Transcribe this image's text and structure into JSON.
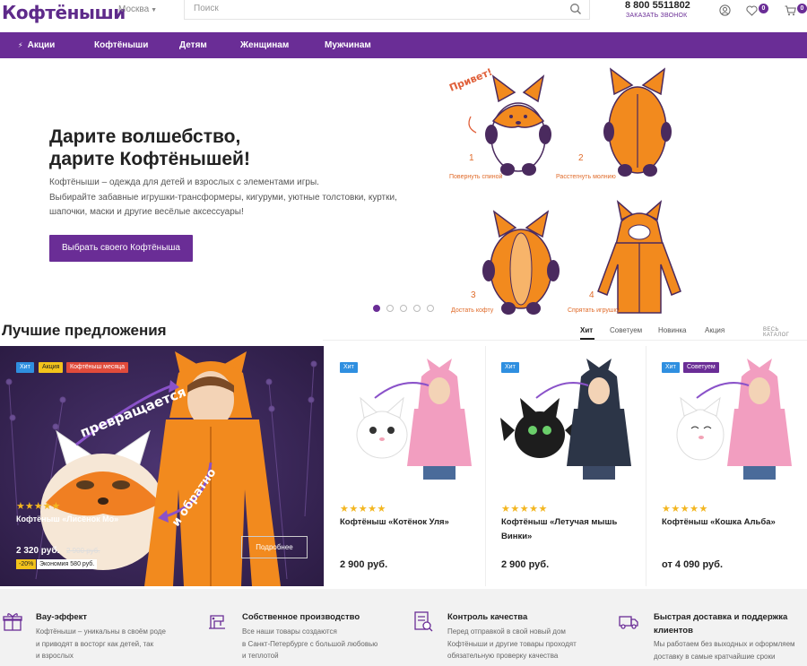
{
  "header": {
    "logo": "Кофтёныши",
    "city": "Москва",
    "search_placeholder": "Поиск",
    "phone": "8 800 5511802",
    "callback": "ЗАКАЗАТЬ ЗВОНОК",
    "wishlist_count": "0",
    "cart_count": "0"
  },
  "nav": {
    "items": [
      "Акции",
      "Кофтёныши",
      "Детям",
      "Женщинам",
      "Мужчинам"
    ]
  },
  "hero": {
    "title_line1": "Дарите волшебство,",
    "title_line2": "дарите Кофтёнышей!",
    "desc_line1": "Кофтёныши – одежда для детей и взрослых с элементами игры.",
    "desc_line2": "Выбирайте забавные игрушки-трансформеры, кигуруми, уютные толстовки, куртки,",
    "desc_line3": "шапочки, маски и другие весёлые аксессуары!",
    "button": "Выбрать своего Кофтёныша",
    "greeting": "Привет!",
    "steps": [
      {
        "num": "1",
        "label": "Повернуть спиной"
      },
      {
        "num": "2",
        "label": "Расстегнуть молнию"
      },
      {
        "num": "3",
        "label": "Достать кофту"
      },
      {
        "num": "4",
        "label": "Спрятать игрушку"
      }
    ]
  },
  "offers": {
    "title": "Лучшие предложения",
    "tabs": [
      "Хит",
      "Советуем",
      "Новинка",
      "Акция"
    ],
    "catalog_link": "ВЕСЬ КАТАЛОГ",
    "transform_text": "превращается",
    "reverse_text": "и обратно",
    "featured": {
      "tags": [
        "Хит",
        "Акция",
        "Кофтёныш месяца"
      ],
      "stars": "★★★★★",
      "name": "Кофтёныш «Лисёнок Мо»",
      "price": "2 320 руб.",
      "old_price": "2 900 руб.",
      "discount": "-20%",
      "economy": "Экономия 580 руб.",
      "more_button": "Подробнее"
    },
    "products": [
      {
        "tags": [
          "Хит"
        ],
        "stars": "★★★★★",
        "name": "Кофтёныш «Котёнок Уля»",
        "price": "2 900 руб."
      },
      {
        "tags": [
          "Хит"
        ],
        "stars": "★★★★★",
        "name": "Кофтёныш «Летучая мышь Винки»",
        "price": "2 900 руб."
      },
      {
        "tags": [
          "Хит",
          "Советуем"
        ],
        "stars": "★★★★★",
        "name": "Кофтёныш «Кошка Альба»",
        "price": "от 4 090 руб."
      }
    ]
  },
  "features": [
    {
      "title": "Вау-эффект",
      "text1": "Кофтёныши – уникальны в своём роде",
      "text2": "и приводят в восторг как детей, так",
      "text3": "и взрослых"
    },
    {
      "title": "Собственное производство",
      "text1": "Все наши товары создаются",
      "text2": "в Санкт-Петербурге с большой любовью",
      "text3": "и теплотой"
    },
    {
      "title": "Контроль качества",
      "text1": "Перед отправкой в свой новый дом",
      "text2": "Кофтёныши и другие товары проходят",
      "text3": "обязательную проверку качества"
    },
    {
      "title": "Быстрая доставка и поддержка клиентов",
      "text1": "Мы работаем без выходных и оформляем",
      "text2": "доставку в самые кратчайшие сроки",
      "text3": ""
    }
  ]
}
